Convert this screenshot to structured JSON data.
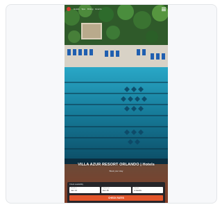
{
  "nav": {
    "items": [
      "Hotels",
      "Spa",
      "Dining",
      "Events"
    ]
  },
  "hero": {
    "title": "VILLA AZUR RESORT ORLANDO | Hotels",
    "subtitle": "Book your stay"
  },
  "booking": {
    "heading": "Check availability",
    "fields": [
      {
        "label": "Check in",
        "value": "Jan 14"
      },
      {
        "label": "Check out",
        "value": "Jan 15"
      },
      {
        "label": "Guests",
        "value": "2 Adults"
      }
    ],
    "search_label": "CHECK RATES"
  },
  "colors": {
    "accent": "#e2552b",
    "pool": "#1a8fb0",
    "deck": "#d8d2c6"
  }
}
